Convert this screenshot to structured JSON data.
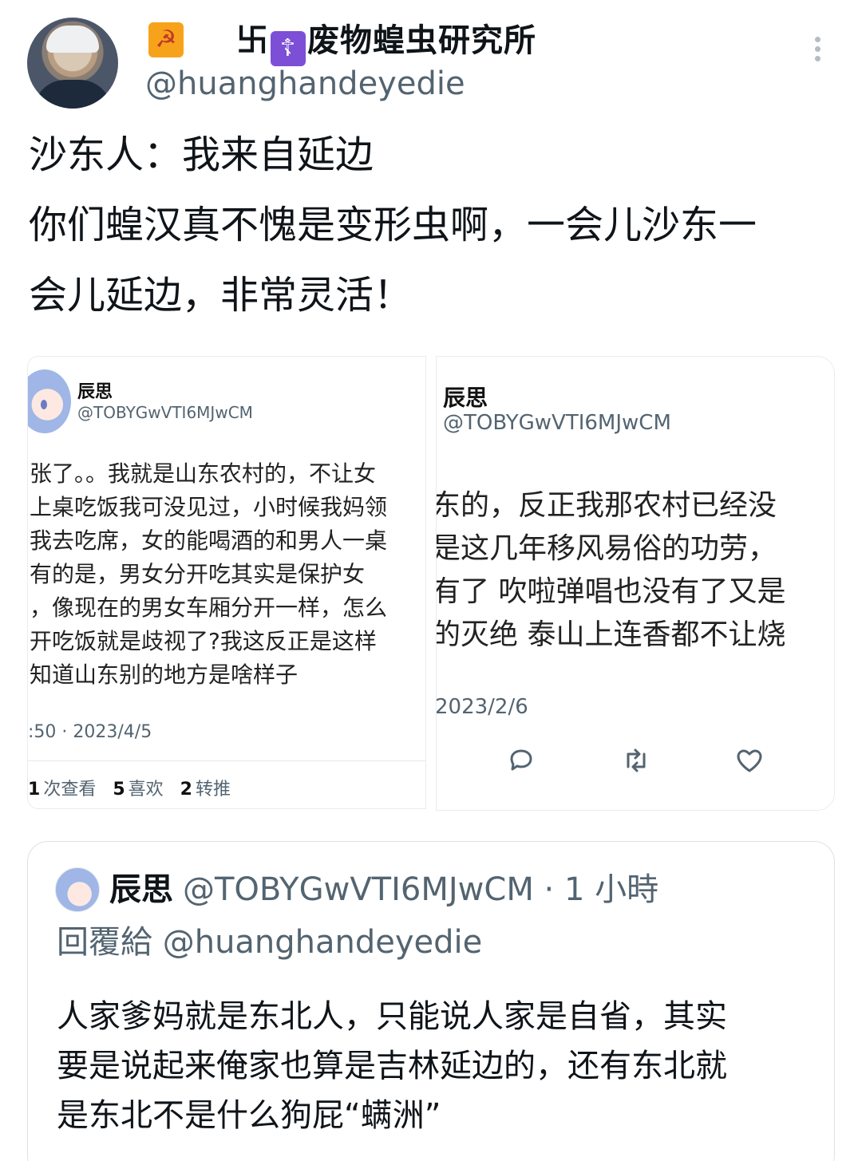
{
  "header": {
    "badge_glyph": "☭",
    "name_prefix": "卐",
    "name_cross": "☦",
    "name_main": "废物蝗虫研究所",
    "handle": "@huanghandeyedie"
  },
  "tweet": {
    "lines": [
      "沙东人：我来自延边",
      "你们蝗汉真不愧是变形虫啊，一会儿沙东一",
      "会儿延边，非常灵活！"
    ]
  },
  "card_left": {
    "name": "辰思",
    "handle": "@TOBYGwVTI6MJwCM",
    "lines": [
      "张了。。我就是山东农村的，不让女",
      "上桌吃饭我可没见过，小时候我妈领",
      "我去吃席，女的能喝酒的和男人一桌",
      "有的是，男女分开吃其实是保护女",
      "，像现在的男女车厢分开一样，怎么",
      "开吃饭就是歧视了?我这反正是这样",
      "知道山东别的地方是啥样子"
    ],
    "time": ":50 · 2023/4/5",
    "stats": {
      "views_count": "1",
      "views_label": "次查看",
      "likes_count": "5",
      "likes_label": "喜欢",
      "retweets_count": "2",
      "retweets_label": "转推"
    }
  },
  "card_right": {
    "name": "辰思",
    "handle": "@TOBYGwVTI6MJwCM",
    "lines": [
      "东的，反正我那农村已经没",
      "是这几年移风易俗的功劳，",
      "有了 吹啦弹唱也没有了又是",
      "的灭绝 泰山上连香都不让烧"
    ],
    "date": "2023/2/6",
    "actions": [
      "reply-icon",
      "retweet-icon",
      "like-icon"
    ]
  },
  "reply": {
    "name": "辰思",
    "meta": "@TOBYGwVTI6MJwCM · 1 小時",
    "reply_to": "回覆給 @huanghandeyedie",
    "lines": [
      "人家爹妈就是东北人，只能说人家是自省，其实",
      "要是说起来俺家也算是吉林延边的，还有东北就",
      "是东北不是什么狗屁“螨洲”"
    ]
  }
}
